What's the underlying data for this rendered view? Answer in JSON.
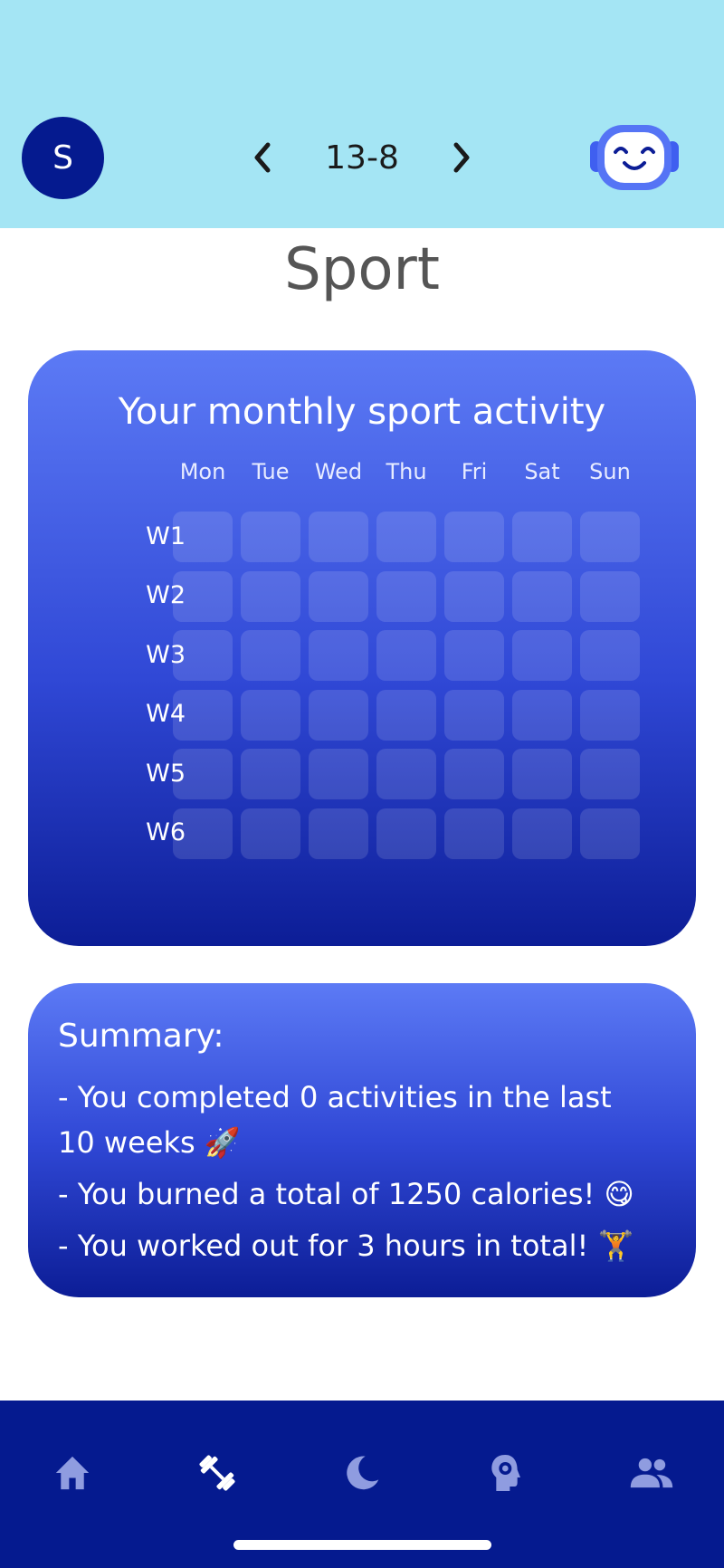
{
  "header": {
    "avatar_letter": "S",
    "date": "13-8",
    "prev_icon": "chevron-left-icon",
    "next_icon": "chevron-right-icon",
    "assistant_icon": "robot-icon"
  },
  "page": {
    "title": "Sport"
  },
  "activity": {
    "title": "Your monthly sport activity",
    "days": [
      "Mon",
      "Tue",
      "Wed",
      "Thu",
      "Fri",
      "Sat",
      "Sun"
    ],
    "weeks": [
      "W1",
      "W2",
      "W3",
      "W4",
      "W5",
      "W6"
    ]
  },
  "summary": {
    "title": "Summary:",
    "line1": " - You completed 0 activities in the last",
    "line1b": "10 weeks 🚀",
    "line2": " - You burned a total of 1250 calories! 😋",
    "line3": " - You worked out for 3 hours in total! 🏋️"
  },
  "nav": {
    "items": [
      {
        "icon": "home-icon",
        "active": false
      },
      {
        "icon": "dumbbell-icon",
        "active": true
      },
      {
        "icon": "moon-icon",
        "active": false
      },
      {
        "icon": "mind-gear-icon",
        "active": false
      },
      {
        "icon": "people-icon",
        "active": false
      }
    ],
    "active_color": "#ffffff",
    "inactive_color": "#8f9ce0"
  },
  "colors": {
    "header_bg": "#a4e5f4",
    "brand_dark": "#051a8f",
    "card_top": "#5c7af5",
    "card_bottom": "#0c1d96"
  }
}
